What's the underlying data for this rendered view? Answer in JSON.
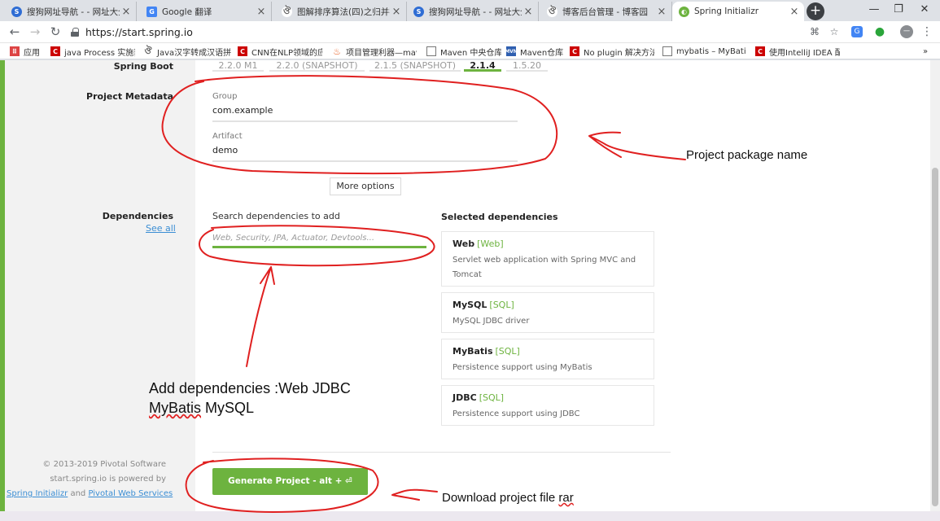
{
  "browser": {
    "tabs": [
      {
        "title": "搜狗网址导航 - - 网址大全实",
        "favicon_color": "#2f6dd4"
      },
      {
        "title": "Google 翻译",
        "favicon_color": "#4285f4"
      },
      {
        "title": "图解排序算法(四)之归并排序",
        "favicon_color": "#555555"
      },
      {
        "title": "搜狗网址导航 - - 网址大全实",
        "favicon_color": "#2f6dd4"
      },
      {
        "title": "博客后台管理 - 博客园",
        "favicon_color": "#555555"
      },
      {
        "title": "Spring Initializr",
        "favicon_color": "#6db33f"
      }
    ],
    "url": "https://start.spring.io",
    "bookmarks": [
      {
        "label": "应用",
        "color": "#d44"
      },
      {
        "label": "java Process 实施获",
        "color": "#c00"
      },
      {
        "label": "Java汉字转成汉语拼",
        "color": "#555"
      },
      {
        "label": "CNN在NLP领域的应",
        "color": "#c00"
      },
      {
        "label": "项目管理利器—mave",
        "color": "#e85a1c"
      },
      {
        "label": "Maven 中央仓库",
        "color": "#777"
      },
      {
        "label": "Maven仓库",
        "color": "#2f5fb0"
      },
      {
        "label": "No plugin 解决方法",
        "color": "#c00"
      },
      {
        "label": "mybatis – MyBatis",
        "color": "#777"
      },
      {
        "label": "使用IntelliJ IDEA 配",
        "color": "#c00"
      }
    ],
    "more_bookmarks": "»"
  },
  "initializr": {
    "spring_boot_label": "Spring Boot",
    "versions": [
      "2.2.0 M1",
      "2.2.0 (SNAPSHOT)",
      "2.1.5 (SNAPSHOT)",
      "2.1.4",
      "1.5.20"
    ],
    "selected_version": "2.1.4",
    "metadata_label": "Project Metadata",
    "group_label": "Group",
    "group_value": "com.example",
    "artifact_label": "Artifact",
    "artifact_value": "demo",
    "more_options": "More options",
    "dependencies_label": "Dependencies",
    "see_all": "See all",
    "search_label": "Search dependencies to add",
    "search_placeholder": "Web, Security, JPA, Actuator, Devtools...",
    "selected_title": "Selected dependencies",
    "selected": [
      {
        "name": "Web",
        "tag": "[Web]",
        "desc": "Servlet web application with Spring MVC and Tomcat"
      },
      {
        "name": "MySQL",
        "tag": "[SQL]",
        "desc": "MySQL JDBC driver"
      },
      {
        "name": "MyBatis",
        "tag": "[SQL]",
        "desc": "Persistence support using MyBatis"
      },
      {
        "name": "JDBC",
        "tag": "[SQL]",
        "desc": "Persistence support using JDBC"
      }
    ],
    "generate_button": "Generate Project - alt + ⏎",
    "footer": {
      "copyright": "© 2013-2019 Pivotal Software",
      "powered": "start.spring.io is powered by",
      "link1": "Spring Initializr",
      "and": "and",
      "link2": "Pivotal Web Services"
    }
  },
  "annotations": {
    "package_note": "Project package name",
    "deps_note_line1": "Add dependencies :Web JDBC",
    "deps_note_line2_word": "MyBatis",
    "deps_note_line2_rest": "MySQL",
    "download_note_main": "Download project file",
    "download_note_word": "rar",
    "ink_color": "#e02020"
  }
}
